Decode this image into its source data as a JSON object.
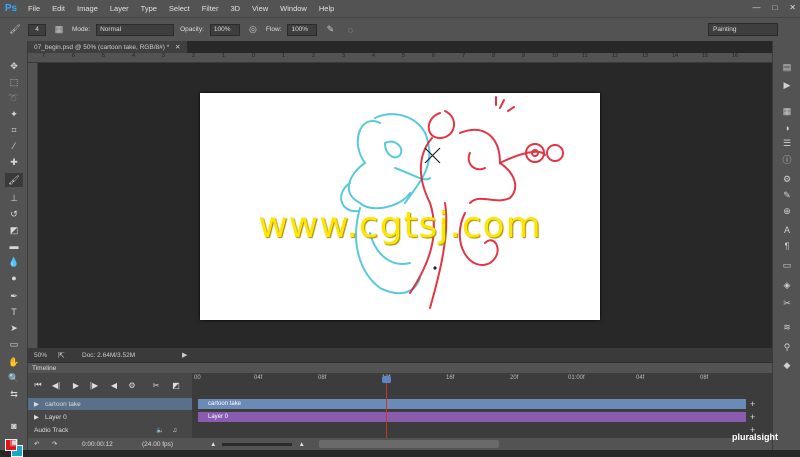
{
  "app": {
    "logo": "Ps"
  },
  "menu": [
    "File",
    "Edit",
    "Image",
    "Layer",
    "Type",
    "Select",
    "Filter",
    "3D",
    "View",
    "Window",
    "Help"
  ],
  "window_controls": {
    "minimize": "—",
    "maximize": "□",
    "close": "✕"
  },
  "options": {
    "brush_size": "4",
    "mode_label": "Mode:",
    "mode_value": "Normal",
    "opacity_label": "Opacity:",
    "opacity_value": "100%",
    "flow_label": "Flow:",
    "flow_value": "100%",
    "workspace": "Painting"
  },
  "document": {
    "tab_title": "07_begin.psd @ 50% (cartoon take, RGB/8#) *",
    "close_glyph": "✕",
    "zoom": "50%",
    "doc_size": "Doc: 2.64M/3.52M",
    "watermark": "www.cgtsj.com"
  },
  "ruler_ticks": [
    "7",
    "6",
    "5",
    "4",
    "3",
    "2",
    "1",
    "0",
    "1",
    "2",
    "3",
    "4",
    "5",
    "6",
    "7",
    "8",
    "9",
    "10",
    "11",
    "12",
    "13",
    "14",
    "15",
    "16"
  ],
  "timeline": {
    "title": "Timeline",
    "frame_labels": [
      "00",
      "04f",
      "08f",
      "12f",
      "16f",
      "20f",
      "01:00f",
      "04f",
      "08f"
    ],
    "tracks": [
      {
        "name": "cartoon take"
      },
      {
        "name": "Layer 0"
      },
      {
        "name": "Audio Track"
      }
    ],
    "clips": [
      {
        "name": "cartoon take",
        "color": "#6a8bb5"
      },
      {
        "name": "Layer 0",
        "color": "#8a5cb0"
      }
    ],
    "timecode": "0:00:00:12",
    "fps": "(24.00 fps)"
  },
  "colors": {
    "foreground": "#e0141c",
    "background": "#1aa6c8"
  },
  "brand": "pluralsight"
}
